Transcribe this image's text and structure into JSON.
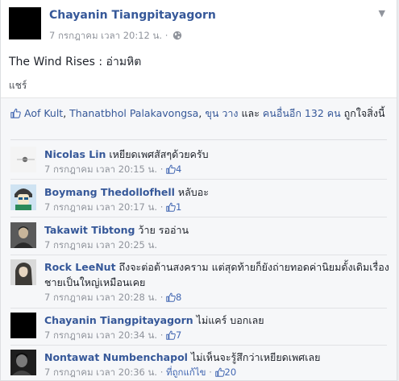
{
  "post": {
    "author": "Chayanin Tiangpitayagorn",
    "timestamp": "7 กรกฎาคม เวลา 20:12 น.",
    "dot": "·",
    "privacy_icon": "globe-icon",
    "text": "The Wind Rises : อ่ามหิต",
    "share_label": "แชร์"
  },
  "likes": {
    "names": [
      "Aof Kult",
      "Thanatbhol Palakavongsa",
      "ขุน วาง"
    ],
    "sep1": ", ",
    "sep2": ", ",
    "and_word": " และ ",
    "others": "คนอื่นอีก 132 คน",
    "suffix": " ถูกใจสิ่งนี้"
  },
  "comments": [
    {
      "author": "Nicolas Lin",
      "text": "เหยียดเพศสัสๆด้วยครับ",
      "time": "7 กรกฎาคม เวลา 20:15 น.",
      "likes": "4",
      "edited": ""
    },
    {
      "author": "Boymang Thedollofhell",
      "text": "หลับอะ",
      "time": "7 กรกฎาคม เวลา 20:17 น.",
      "likes": "1",
      "edited": ""
    },
    {
      "author": "Takawit Tibtong",
      "text": "ว้าย รออ่าน",
      "time": "7 กรกฎาคม เวลา 20:25 น.",
      "likes": "",
      "edited": ""
    },
    {
      "author": "Rock LeeNut",
      "text": "ถึงจะต่อต้านสงคราม แต่สุดท้ายก็ยังถ่ายทอดค่านิยมดั้งเดิมเรื่องชายเป็นใหญ่เหมือนเคย",
      "time": "7 กรกฎาคม เวลา 20:28 น.",
      "likes": "8",
      "edited": ""
    },
    {
      "author": "Chayanin Tiangpitayagorn",
      "text": "ไม่แคร์ บอกเลย",
      "time": "7 กรกฎาคม เวลา 20:34 น.",
      "likes": "7",
      "edited": ""
    },
    {
      "author": "Nontawat Numbenchapol",
      "text": "ไม่เห็นจะรู้สึกว่าเหยียดเพศเลย",
      "time": "7 กรกฎาคม เวลา 20:36 น.",
      "likes": "20",
      "edited": "ที่ถูกแก้ไข"
    }
  ],
  "colors": {
    "link": "#365899",
    "meta": "#90949c",
    "like_blue": "#4267b2"
  }
}
